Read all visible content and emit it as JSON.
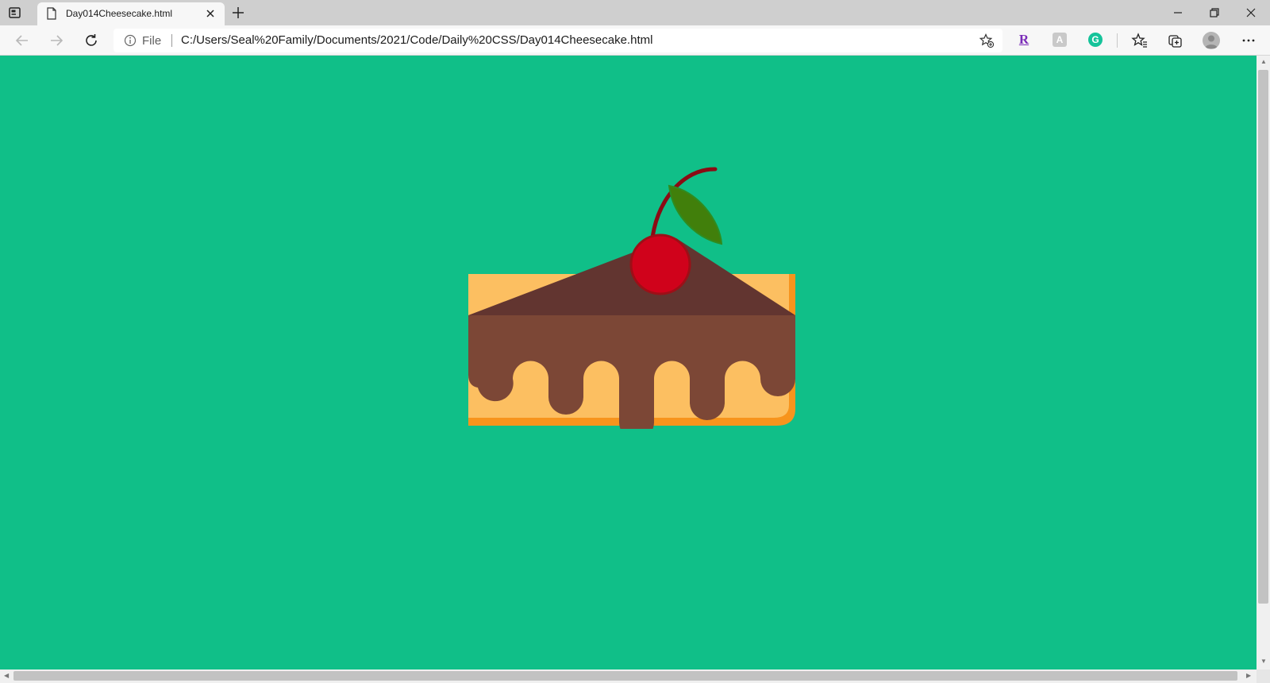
{
  "browser": {
    "tab": {
      "title": "Day014Cheesecake.html",
      "close_icon": "close-icon"
    },
    "new_tab_icon": "plus-icon",
    "window_controls": [
      "minimize-icon",
      "restore-icon",
      "close-icon"
    ],
    "toolbar": {
      "back_icon": "back-arrow-icon",
      "forward_icon": "forward-arrow-icon",
      "refresh_icon": "refresh-icon",
      "address": {
        "scheme_label": "File",
        "url": "C:/Users/Seal%20Family/Documents/2021/Code/Daily%20CSS/Day014Cheesecake.html"
      },
      "extensions": {
        "r_label": "R",
        "box_label": "A",
        "grammarly_label": "G"
      }
    }
  },
  "colors": {
    "page_background": "#10bf88",
    "cake_body": "#fcbf61",
    "cake_base": "#f7941d",
    "chocolate_side": "#7c4736",
    "chocolate_top": "#623530",
    "cherry": "#d0021b",
    "cherry_outline": "#9d0f17",
    "stem": "#8b0b14",
    "leaf": "#417f0b",
    "leaf_outline": "#2f8c1f"
  }
}
